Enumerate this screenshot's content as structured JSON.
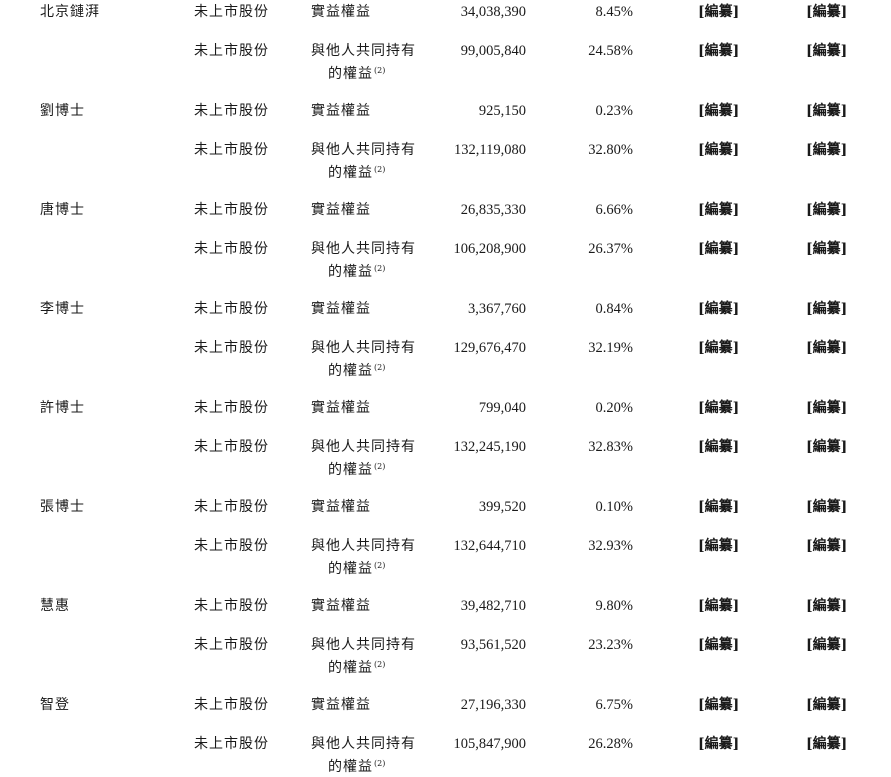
{
  "rows": [
    {
      "holder": "北京鏈湃",
      "class": "未上市股份",
      "nature_l1": "實益權益",
      "nature_l2": "",
      "note": "",
      "shares": "34,038,390",
      "pct": "8.45%",
      "r1": "[編纂]",
      "r2": "[編纂]"
    },
    {
      "holder": "",
      "class": "未上市股份",
      "nature_l1": "與他人共同持有",
      "nature_l2": "的權益",
      "note": "(2)",
      "shares": "99,005,840",
      "pct": "24.58%",
      "r1": "[編纂]",
      "r2": "[編纂]"
    },
    {
      "holder": "劉博士",
      "class": "未上市股份",
      "nature_l1": "實益權益",
      "nature_l2": "",
      "note": "",
      "shares": "925,150",
      "pct": "0.23%",
      "r1": "[編纂]",
      "r2": "[編纂]"
    },
    {
      "holder": "",
      "class": "未上市股份",
      "nature_l1": "與他人共同持有",
      "nature_l2": "的權益",
      "note": "(2)",
      "shares": "132,119,080",
      "pct": "32.80%",
      "r1": "[編纂]",
      "r2": "[編纂]"
    },
    {
      "holder": "唐博士",
      "class": "未上市股份",
      "nature_l1": "實益權益",
      "nature_l2": "",
      "note": "",
      "shares": "26,835,330",
      "pct": "6.66%",
      "r1": "[編纂]",
      "r2": "[編纂]"
    },
    {
      "holder": "",
      "class": "未上市股份",
      "nature_l1": "與他人共同持有",
      "nature_l2": "的權益",
      "note": "(2)",
      "shares": "106,208,900",
      "pct": "26.37%",
      "r1": "[編纂]",
      "r2": "[編纂]"
    },
    {
      "holder": "李博士",
      "class": "未上市股份",
      "nature_l1": "實益權益",
      "nature_l2": "",
      "note": "",
      "shares": "3,367,760",
      "pct": "0.84%",
      "r1": "[編纂]",
      "r2": "[編纂]"
    },
    {
      "holder": "",
      "class": "未上市股份",
      "nature_l1": "與他人共同持有",
      "nature_l2": "的權益",
      "note": "(2)",
      "shares": "129,676,470",
      "pct": "32.19%",
      "r1": "[編纂]",
      "r2": "[編纂]"
    },
    {
      "holder": "許博士",
      "class": "未上市股份",
      "nature_l1": "實益權益",
      "nature_l2": "",
      "note": "",
      "shares": "799,040",
      "pct": "0.20%",
      "r1": "[編纂]",
      "r2": "[編纂]"
    },
    {
      "holder": "",
      "class": "未上市股份",
      "nature_l1": "與他人共同持有",
      "nature_l2": "的權益",
      "note": "(2)",
      "shares": "132,245,190",
      "pct": "32.83%",
      "r1": "[編纂]",
      "r2": "[編纂]"
    },
    {
      "holder": "張博士",
      "class": "未上市股份",
      "nature_l1": "實益權益",
      "nature_l2": "",
      "note": "",
      "shares": "399,520",
      "pct": "0.10%",
      "r1": "[編纂]",
      "r2": "[編纂]"
    },
    {
      "holder": "",
      "class": "未上市股份",
      "nature_l1": "與他人共同持有",
      "nature_l2": "的權益",
      "note": "(2)",
      "shares": "132,644,710",
      "pct": "32.93%",
      "r1": "[編纂]",
      "r2": "[編纂]"
    },
    {
      "holder": "慧惠",
      "class": "未上市股份",
      "nature_l1": "實益權益",
      "nature_l2": "",
      "note": "",
      "shares": "39,482,710",
      "pct": "9.80%",
      "r1": "[編纂]",
      "r2": "[編纂]"
    },
    {
      "holder": "",
      "class": "未上市股份",
      "nature_l1": "與他人共同持有",
      "nature_l2": "的權益",
      "note": "(2)",
      "shares": "93,561,520",
      "pct": "23.23%",
      "r1": "[編纂]",
      "r2": "[編纂]"
    },
    {
      "holder": "智登",
      "class": "未上市股份",
      "nature_l1": "實益權益",
      "nature_l2": "",
      "note": "",
      "shares": "27,196,330",
      "pct": "6.75%",
      "r1": "[編纂]",
      "r2": "[編纂]"
    },
    {
      "holder": "",
      "class": "未上市股份",
      "nature_l1": "與他人共同持有",
      "nature_l2": "的權益",
      "note": "(2)",
      "shares": "105,847,900",
      "pct": "26.28%",
      "r1": "[編纂]",
      "r2": "[編纂]"
    }
  ]
}
